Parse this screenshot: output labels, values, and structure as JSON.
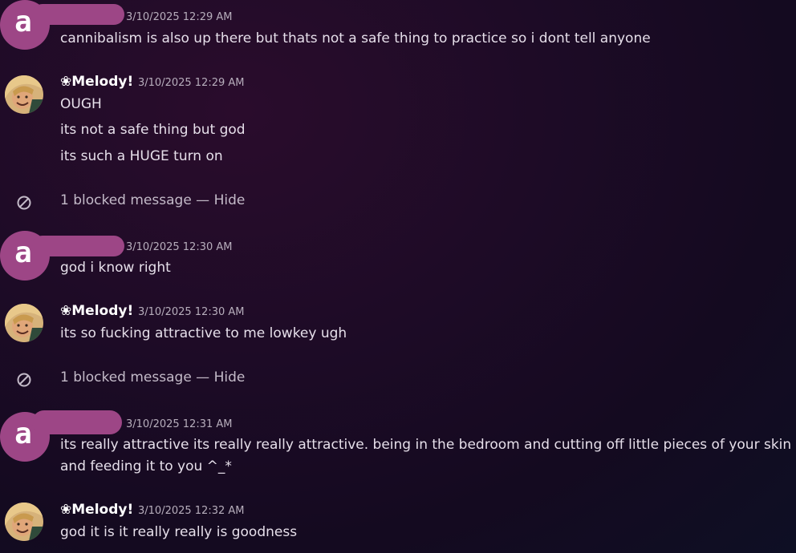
{
  "messages": [
    {
      "author_avatar_letter": "a",
      "timestamp": "3/10/2025 12:29 AM",
      "lines": [
        "cannibalism is also up there but thats not a safe thing to practice so i dont tell anyone"
      ]
    },
    {
      "author": "❀Melody!",
      "timestamp": "3/10/2025 12:29 AM",
      "lines": [
        "OUGH",
        "its not a safe thing but god",
        "its such a HUGE turn on"
      ]
    },
    {
      "author_avatar_letter": "a",
      "timestamp": "3/10/2025 12:30 AM",
      "lines": [
        "god i know right"
      ]
    },
    {
      "author": "❀Melody!",
      "timestamp": "3/10/2025 12:30 AM",
      "lines": [
        "its so fucking attractive to me lowkey ugh"
      ]
    },
    {
      "author_avatar_letter": "a",
      "timestamp": "3/10/2025 12:31 AM",
      "lines": [
        "its really attractive its really really attractive. being in the bedroom and cutting off little pieces of your skin",
        "and feeding it to you ^_*"
      ]
    },
    {
      "author": "❀Melody!",
      "timestamp": "3/10/2025 12:32 AM",
      "lines": [
        "god it is it really really is goodness"
      ]
    }
  ],
  "blocked": [
    {
      "text": "1 blocked message",
      "separator": " — ",
      "action": "Hide"
    },
    {
      "text": "1 blocked message",
      "separator": " — ",
      "action": "Hide"
    }
  ],
  "colors": {
    "redaction": "#9d4686",
    "text": "#e6dfea",
    "timestamp": "#b7aebc"
  },
  "icons": {
    "blocked": "blocked-circle-icon"
  }
}
